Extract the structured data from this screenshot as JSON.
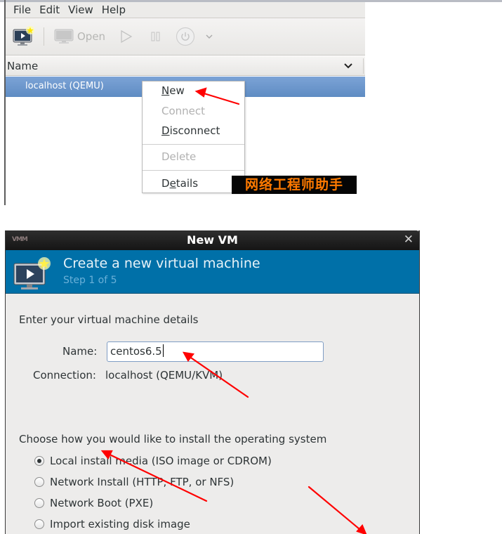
{
  "manager": {
    "menubar": [
      "File",
      "Edit",
      "View",
      "Help"
    ],
    "toolbar": {
      "new_icon": "new-vm-icon",
      "open_label": "Open",
      "run_icon": "play-icon",
      "pause_icon": "pause-icon",
      "shutdown_icon": "power-icon",
      "menu_icon": "chevron-down-icon"
    },
    "list_header": {
      "name_column": "Name"
    },
    "connections": [
      {
        "label": "localhost (QEMU)",
        "selected": true
      }
    ],
    "context_menu": {
      "items": [
        {
          "label_mnemonic": "N",
          "label_rest": "ew",
          "enabled": true
        },
        {
          "label": "Connect",
          "enabled": false
        },
        {
          "label_mnemonic": "D",
          "label_rest": "isconnect",
          "enabled": true
        },
        {
          "label": "Delete",
          "enabled": false
        },
        {
          "label_pre": "D",
          "label_mnemonic": "e",
          "label_rest": "tails",
          "enabled": true
        }
      ]
    },
    "watermark": "网络工程师助手"
  },
  "dialog": {
    "title": "New VM",
    "close_icon": "close-icon",
    "banner": {
      "title": "Create a new virtual machine",
      "step": "Step 1 of 5"
    },
    "section_details": "Enter your virtual machine details",
    "name_label": "Name:",
    "name_value": "centos6.5",
    "connection_label": "Connection:",
    "connection_value": "localhost (QEMU/KVM)",
    "section_install": "Choose how you would like to install the operating system",
    "install_options": [
      {
        "label": "Local install media (ISO image or CDROM)",
        "checked": true
      },
      {
        "label": "Network Install (HTTP, FTP, or NFS)",
        "checked": false
      },
      {
        "label": "Network Boot (PXE)",
        "checked": false
      },
      {
        "label": "Import existing disk image",
        "checked": false
      }
    ]
  },
  "colors": {
    "selection_blue": "#6f98cd",
    "banner_blue": "#0070a8",
    "annotation_red": "#ff0000",
    "watermark_orange": "#ff7a00"
  }
}
